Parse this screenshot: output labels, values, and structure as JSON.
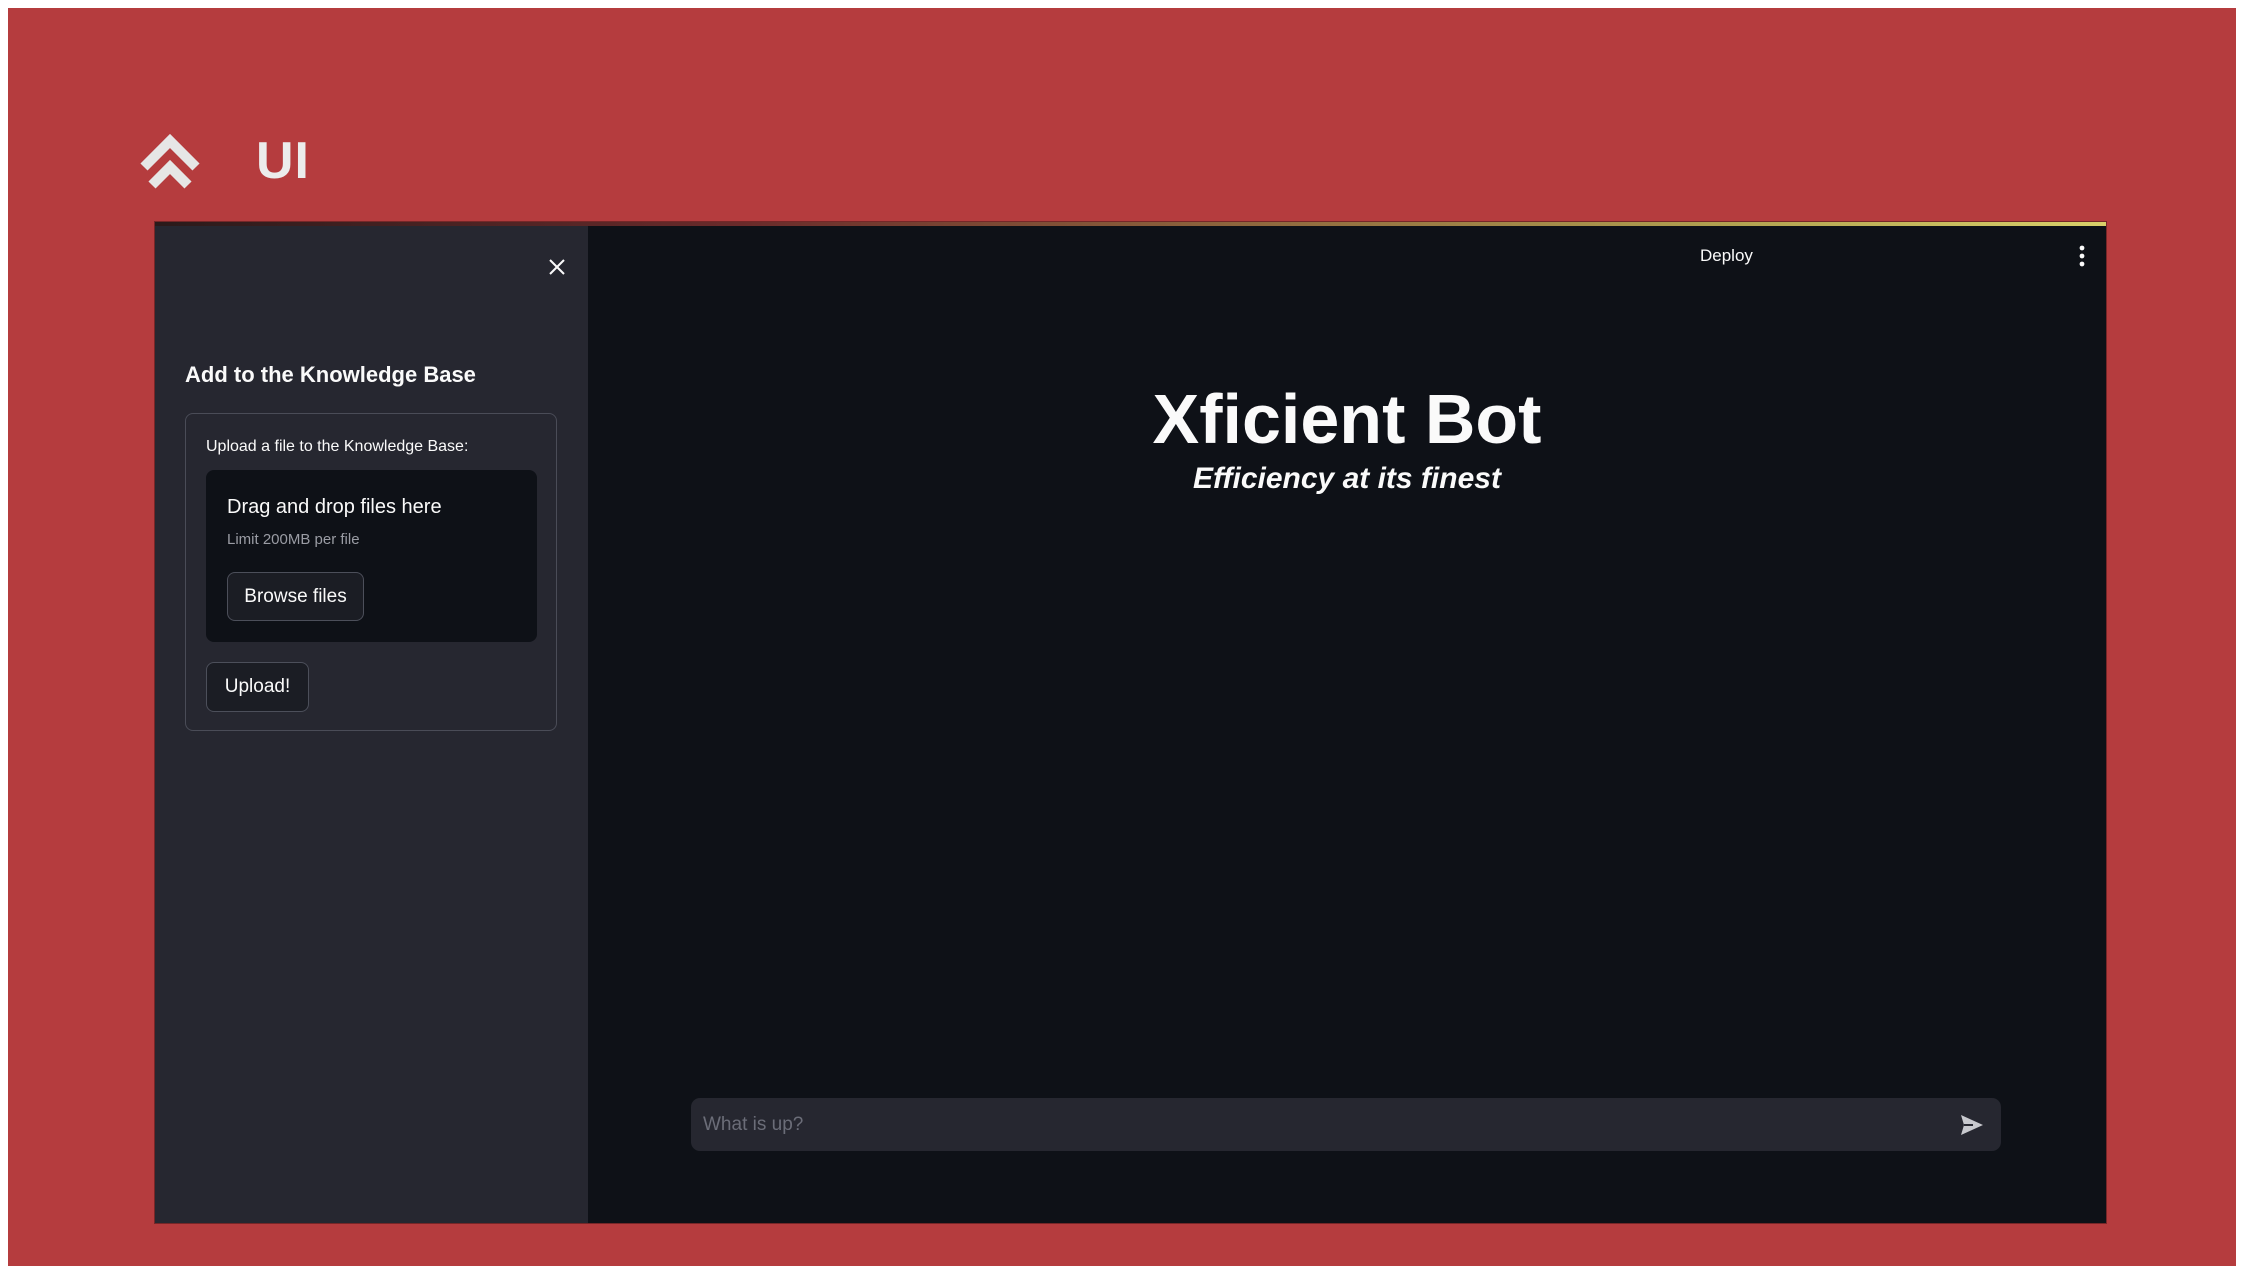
{
  "brand": {
    "logo_icon": "chevron-stack-logo",
    "text": "UI"
  },
  "sidebar": {
    "close_icon": "close-icon",
    "heading": "Add to the Knowledge Base",
    "uploader": {
      "label": "Upload a file to the Knowledge Base:",
      "drop_title": "Drag and drop files here",
      "limit": "Limit 200MB per file",
      "browse_label": "Browse files"
    },
    "upload_button_label": "Upload!"
  },
  "header": {
    "deploy_label": "Deploy",
    "menu_icon": "kebab-menu-icon"
  },
  "main": {
    "title": "Xficient Bot",
    "subtitle": "Efficiency at its finest"
  },
  "chat": {
    "placeholder": "What is up?",
    "value": "",
    "send_icon": "send-icon"
  },
  "colors": {
    "background_frame": "#b53c3e",
    "app_background": "#0e1117",
    "sidebar_background": "#262730",
    "text": "#fafafa"
  }
}
